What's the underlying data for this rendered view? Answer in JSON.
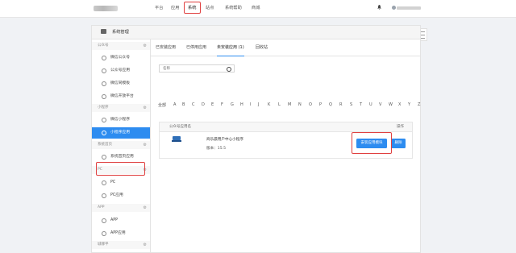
{
  "topnav": {
    "items": [
      "平台",
      "应用",
      "系统",
      "站点",
      "系统帮助",
      "商城"
    ]
  },
  "panel": {
    "title": "系统管理"
  },
  "sidebar": {
    "sections": [
      {
        "title": "公众号",
        "items": [
          "微信公众号",
          "公众号应用",
          "微信同模板",
          "微信开放平台"
        ]
      },
      {
        "title": "小程序",
        "items": [
          "微信小程序",
          "小程序应用"
        ]
      },
      {
        "title": "系统首页",
        "items": [
          "系统首页应用"
        ]
      },
      {
        "title": "PC",
        "items": [
          "PC",
          "PC应用"
        ]
      },
      {
        "title": "APP",
        "items": [
          "APP",
          "APP应用"
        ]
      },
      {
        "title": "城哪平"
      }
    ]
  },
  "tabs": [
    "已安装应用",
    "已停用应用",
    "未安装应用 (1)",
    "回收站"
  ],
  "search": {
    "placeholder": "名称"
  },
  "letters": [
    "全部",
    "A",
    "B",
    "C",
    "D",
    "E",
    "F",
    "G",
    "H",
    "I",
    "J",
    "K",
    "L",
    "M",
    "N",
    "O",
    "P",
    "Q",
    "R",
    "S",
    "T",
    "U",
    "V",
    "W",
    "X",
    "Y",
    "Z"
  ],
  "table": {
    "col_name": "公众号应用名",
    "col_action": "操作",
    "row": {
      "name": "商乐晨用户中心小程序",
      "version": "版本：15.5",
      "install_label": "安装应用模块",
      "delete_label": "删除"
    }
  },
  "colors": {
    "accent": "#2d8cf0",
    "highlight": "#e04040"
  }
}
